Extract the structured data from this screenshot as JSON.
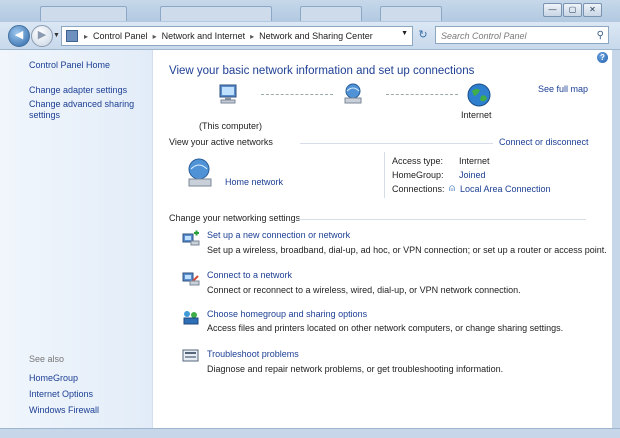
{
  "breadcrumb": [
    "Control Panel",
    "Network and Internet",
    "Network and Sharing Center"
  ],
  "search": {
    "placeholder": "Search Control Panel"
  },
  "window_controls": {
    "minimize": "—",
    "maximize": "▢",
    "close": "✕"
  },
  "sidebar": {
    "home": "Control Panel Home",
    "tasks": [
      "Change adapter settings",
      "Change advanced sharing settings"
    ],
    "see_also_label": "See also",
    "see_also": [
      "HomeGroup",
      "Internet Options",
      "Windows Firewall"
    ]
  },
  "main": {
    "heading": "View your basic network information and set up connections",
    "see_full_map": "See full map",
    "map": {
      "computer_label": "(This computer)",
      "internet_label": "Internet"
    },
    "active_networks_title": "View your active networks",
    "connect_or_disconnect": "Connect or disconnect",
    "network_name": "Home network",
    "access_type_label": "Access type:",
    "access_type_value": "Internet",
    "homegroup_label": "HomeGroup:",
    "homegroup_value": "Joined",
    "connections_label": "Connections:",
    "connections_value": "Local Area Connection",
    "change_settings_title": "Change your networking settings",
    "tasks": [
      {
        "title": "Set up a new connection or network",
        "desc": "Set up a wireless, broadband, dial-up, ad hoc, or VPN connection; or set up a router or access point."
      },
      {
        "title": "Connect to a network",
        "desc": "Connect or reconnect to a wireless, wired, dial-up, or VPN network connection."
      },
      {
        "title": "Choose homegroup and sharing options",
        "desc": "Access files and printers located on other network computers, or change sharing settings."
      },
      {
        "title": "Troubleshoot problems",
        "desc": "Diagnose and repair network problems, or get troubleshooting information."
      }
    ]
  },
  "icons": [
    "back-arrow-icon",
    "forward-arrow-icon",
    "control-panel-icon",
    "refresh-icon",
    "search-icon",
    "help-icon",
    "computer-icon",
    "network-icon",
    "globe-icon",
    "network-bench-icon",
    "plug-icon",
    "connection-setup-icon",
    "connect-network-icon",
    "homegroup-icon",
    "troubleshoot-icon"
  ]
}
